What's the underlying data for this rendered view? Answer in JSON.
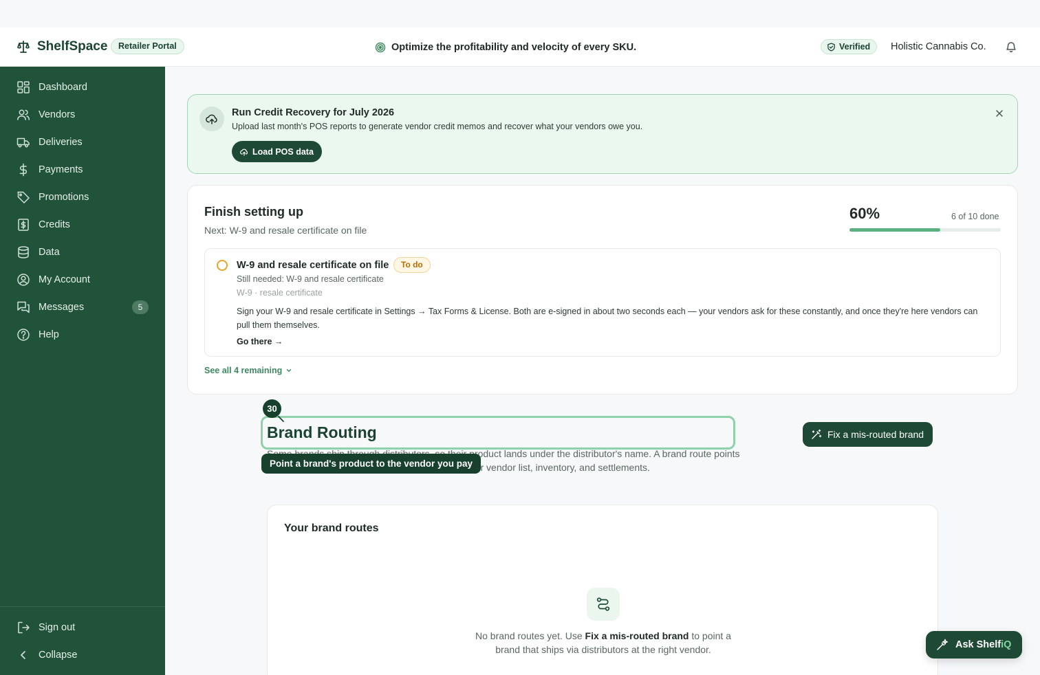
{
  "header": {
    "app_name": "ShelfSpace",
    "portal_badge": "Retailer Portal",
    "tagline": "Optimize the profitability and velocity of every SKU.",
    "verified_label": "Verified",
    "company_name": "Holistic Cannabis Co."
  },
  "sidebar": {
    "items": [
      {
        "label": "Dashboard",
        "icon": "dashboard-icon"
      },
      {
        "label": "Vendors",
        "icon": "users-icon"
      },
      {
        "label": "Deliveries",
        "icon": "truck-icon"
      },
      {
        "label": "Payments",
        "icon": "dollar-icon"
      },
      {
        "label": "Promotions",
        "icon": "tag-icon"
      },
      {
        "label": "Credits",
        "icon": "receipt-icon"
      },
      {
        "label": "Data",
        "icon": "database-icon"
      },
      {
        "label": "My Account",
        "icon": "user-circle-icon"
      },
      {
        "label": "Messages",
        "icon": "messages-icon",
        "count": "5"
      },
      {
        "label": "Help",
        "icon": "help-icon"
      }
    ],
    "sign_out": "Sign out",
    "collapse": "Collapse"
  },
  "banner": {
    "title": "Run Credit Recovery for July 2026",
    "description": "Upload last month's POS reports to generate vendor credit memos and recover what your vendors owe you.",
    "button": "Load POS data"
  },
  "setup": {
    "title": "Finish setting up",
    "next": "Next: W-9 and resale certificate on file",
    "percent_label": "60%",
    "progress": 0.6,
    "done_label": "6 of 10 done",
    "task": {
      "title": "W-9 and resale certificate on file",
      "status": "To do",
      "needed": "Still needed: W-9 and resale certificate",
      "tags": "W-9 · resale certificate",
      "body": "Sign your W-9 and resale certificate in Settings → Tax Forms & License. Both are e-signed in about two seconds each — your vendors ask for these constantly, and once they're here vendors can pull them themselves.",
      "link": "Go there →"
    },
    "see_all": "See all 4 remaining"
  },
  "walkthrough": {
    "step": "30",
    "tooltip": "Point a brand's product to the vendor you pay"
  },
  "page": {
    "title": "Brand Routing",
    "description": "Some brands ship through distributors, so their product lands under the distributor's name. A brand route points that product to the correct brand vendor — for your vendor list, inventory, and settlements.",
    "fix_button": "Fix a mis-routed brand"
  },
  "routes": {
    "title": "Your brand routes",
    "empty_prefix": "No brand routes yet. Use ",
    "empty_bold": "Fix a mis-routed brand",
    "empty_suffix": " to point a brand that ships via distributors at the right vendor."
  },
  "assistant": {
    "label": "Ask Shelf",
    "accent": "iQ"
  },
  "colors": {
    "sidebar": "#21523a",
    "primary": "#1e4a35",
    "accent_green": "#5bb07f",
    "todo_orange": "#e8a42a",
    "banner_bg": "#ebf8f0"
  }
}
